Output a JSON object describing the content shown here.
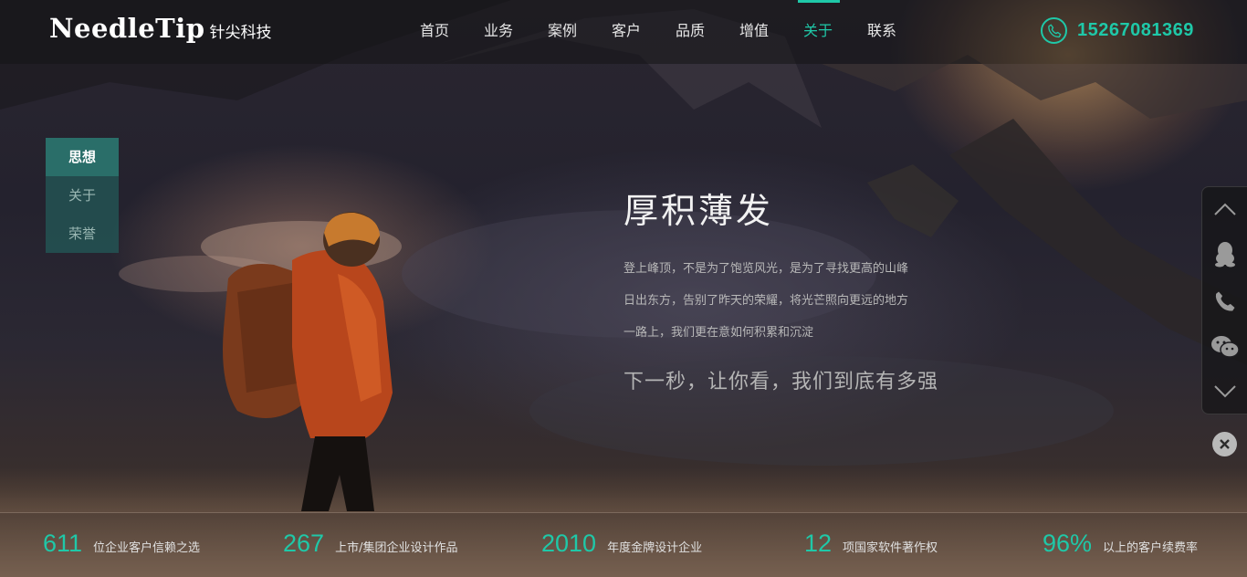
{
  "brand": {
    "name_en": "NeedleTip",
    "name_cn": "针尖科技"
  },
  "colors": {
    "accent": "#1fc8a8",
    "side_tab_bg": "#2a6e69"
  },
  "nav": {
    "items": [
      {
        "label": "首页",
        "active": false
      },
      {
        "label": "业务",
        "active": false
      },
      {
        "label": "案例",
        "active": false
      },
      {
        "label": "客户",
        "active": false
      },
      {
        "label": "品质",
        "active": false
      },
      {
        "label": "增值",
        "active": false
      },
      {
        "label": "关于",
        "active": true
      },
      {
        "label": "联系",
        "active": false
      }
    ]
  },
  "contact": {
    "icon": "phone-icon",
    "phone": "15267081369"
  },
  "side_tabs": {
    "items": [
      {
        "label": "思想",
        "active": true
      },
      {
        "label": "关于",
        "active": false
      },
      {
        "label": "荣誉",
        "active": false
      }
    ]
  },
  "hero": {
    "title": "厚积薄发",
    "lines": [
      "登上峰顶，不是为了饱览风光，是为了寻找更高的山峰",
      "日出东方，告别了昨天的荣耀，将光芒照向更远的地方",
      "一路上，我们更在意如何积累和沉淀"
    ],
    "tagline": "下一秒，让你看，我们到底有多强"
  },
  "toolbar": {
    "icons": [
      "chevron-up-icon",
      "qq-icon",
      "phone-icon",
      "wechat-icon",
      "chevron-down-icon",
      "close-icon"
    ]
  },
  "stats": {
    "items": [
      {
        "number": "611",
        "label": "位企业客户信赖之选"
      },
      {
        "number": "267",
        "label": "上市/集团企业设计作品"
      },
      {
        "number": "2010",
        "label": "年度金牌设计企业"
      },
      {
        "number": "12",
        "label": "项国家软件著作权"
      },
      {
        "number": "96%",
        "label": "以上的客户续费率"
      }
    ]
  }
}
